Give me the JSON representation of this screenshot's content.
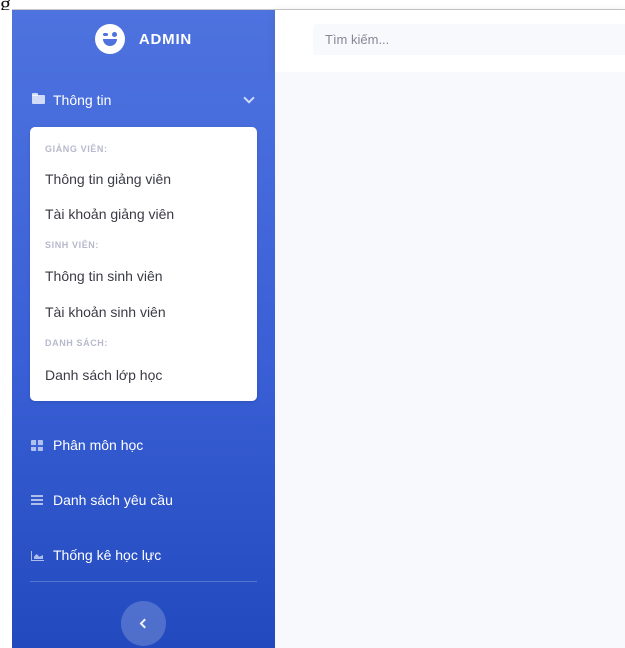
{
  "brand": {
    "name": "ADMIN"
  },
  "sidebar": {
    "expanded_section": {
      "label": "Thông tin",
      "groups": [
        {
          "header": "GIẢNG VIÊN:",
          "items": [
            "Thông tin giảng viên",
            "Tài khoản giảng viên"
          ]
        },
        {
          "header": "SINH VIÊN:",
          "items": [
            "Thông tin sinh viên",
            "Tài khoản sinh viên"
          ]
        },
        {
          "header": "DANH SÁCH:",
          "items": [
            "Danh sách lớp học"
          ]
        }
      ]
    },
    "nav_items": [
      {
        "label": "Phân môn học",
        "icon": "table-icon"
      },
      {
        "label": "Danh sách yêu cầu",
        "icon": "list-icon"
      },
      {
        "label": "Thống kê học lực",
        "icon": "chart-area-icon"
      }
    ],
    "toggle_icon": "chevron-left-icon",
    "gradient_start": "#4e73df",
    "gradient_end": "#224abe"
  },
  "topbar": {
    "search": {
      "placeholder": "Tìm kiếm..."
    }
  },
  "content": {
    "background": "#f8f9fc"
  }
}
